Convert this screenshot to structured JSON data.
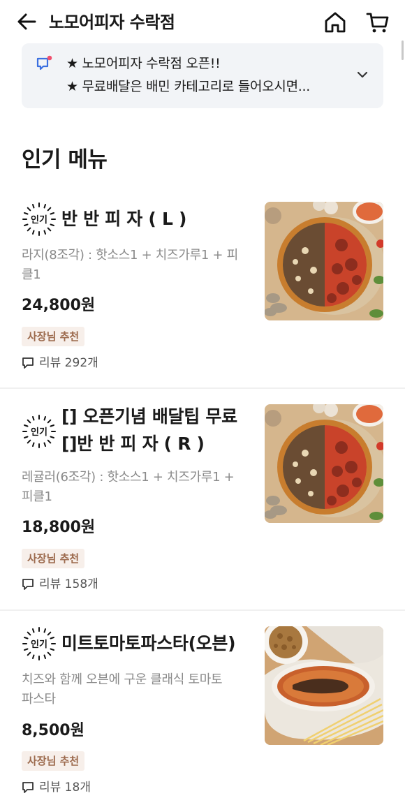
{
  "header": {
    "title": "노모어피자 수락점",
    "back_icon": "arrow-left-icon",
    "home_icon": "home-icon",
    "cart_icon": "cart-icon"
  },
  "notice": {
    "icon": "megaphone-icon",
    "line1": "★ 노모어피자 수락점 오픈!!",
    "line2": "★ 무료배달은 배민 카테고리로 들어오시면...",
    "expand_icon": "chevron-down-icon"
  },
  "section": {
    "title": "인기 메뉴"
  },
  "popular_badge_text": "인기",
  "items": [
    {
      "name_line1": "반 반 피 자 ( L )",
      "name_line2": "",
      "desc_line1": "라지(8조각) : 핫소스1 + 치즈가루1 + 피",
      "desc_line2": "클1",
      "price": "24,800원",
      "recommend": "사장님 추천",
      "review": "리뷰 292개"
    },
    {
      "name_line1": "[] 오픈기념 배달팁 무료",
      "name_line2": "[]반 반 피 자 ( R )",
      "desc_line1": "레귤러(6조각) : 핫소스1 + 치즈가루1 +",
      "desc_line2": "피클1",
      "price": "18,800원",
      "recommend": "사장님 추천",
      "review": "리뷰 158개"
    },
    {
      "name_line1": "미트토마토파스타(오븐)",
      "name_line2": "",
      "desc_line1": "치즈와 함께 오븐에 구운 클래식 토마토",
      "desc_line2": "파스타",
      "price": "8,500원",
      "recommend": "사장님 추천",
      "review": "리뷰 18개"
    }
  ]
}
